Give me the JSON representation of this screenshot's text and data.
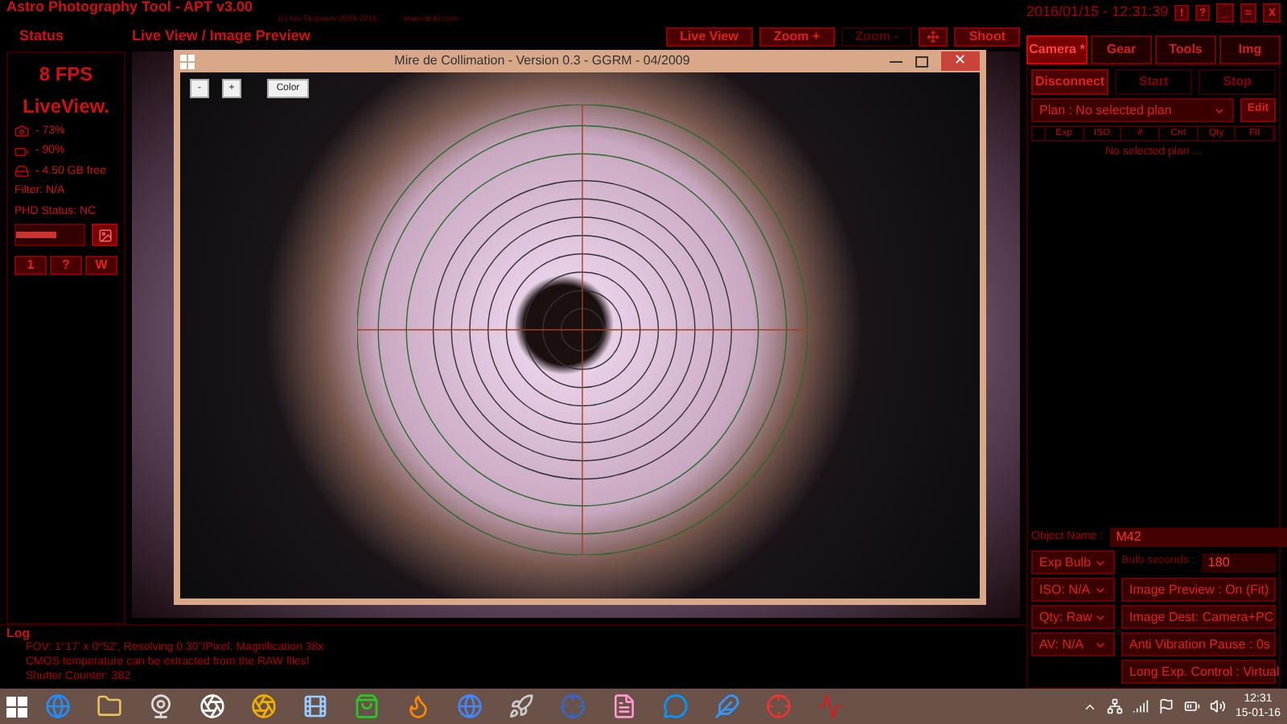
{
  "app": {
    "title": "Astro Photography Tool - APT v3.00",
    "copyright": "(c) Ivo Stoyanov 2009-2015",
    "website": "www.ideiki.com",
    "datetime": "2016/01/15 - 12:31:39",
    "close_glyph": "✕",
    "header_buttons": [
      "!",
      "?"
    ],
    "window_buttons": [
      "_",
      "=",
      "X"
    ]
  },
  "status": {
    "title": "Status",
    "fps": "8 FPS",
    "mode": "LiveView.",
    "rows": [
      {
        "kind": "camera",
        "text": "- 73%"
      },
      {
        "kind": "battery",
        "text": "- 90%"
      },
      {
        "kind": "disk",
        "text": "- 4.50 GB free"
      }
    ],
    "filter": "Filter: N/A",
    "phd": "PHD Status: NC",
    "slider": {
      "level": 0.6
    },
    "buttons": [
      "1",
      "?",
      "W"
    ]
  },
  "preview": {
    "title": "Live View / Image Preview",
    "toolbar": [
      {
        "kind": "text",
        "label": "Live View",
        "enabled": true
      },
      {
        "kind": "text",
        "label": "Zoom +",
        "enabled": true
      },
      {
        "kind": "text",
        "label": "Zoom -",
        "enabled": false
      },
      {
        "kind": "icon",
        "enabled": true
      },
      {
        "kind": "text",
        "label": "Shoot",
        "enabled": true
      }
    ]
  },
  "collimation_window": {
    "title": "Mire de Collimation - Version 0.3 - GGRM - 04/2009",
    "buttons": [
      "-",
      "+",
      "Color"
    ]
  },
  "log": {
    "title": "Log",
    "lines": [
      "FOV: 1°17' x 0°52', Resolving 0.30\"/Pixel, Magnification 38x",
      "CMOS temperature can be extracted from the RAW files!",
      "Shutter Counter: 382"
    ]
  },
  "tabs": [
    {
      "label": "Camera *",
      "selected": true
    },
    {
      "label": "Gear",
      "selected": false
    },
    {
      "label": "Tools",
      "selected": false
    },
    {
      "label": "Img",
      "selected": false
    }
  ],
  "camera": {
    "actions": [
      {
        "label": "Disconnect",
        "enabled": true
      },
      {
        "label": "Start",
        "enabled": false
      },
      {
        "label": "Stop",
        "enabled": false
      }
    ],
    "plan": "Plan : No selected plan",
    "edit": "Edit",
    "columns": [
      "Exp",
      "ISO",
      "#",
      "Cnt",
      "Qty",
      "Flt"
    ],
    "empty": "No selected plan ...",
    "object_label": "Object Name :",
    "object_value": "M42",
    "bulb_label": "Bulb seconds :",
    "bulb_value": "180",
    "left_settings": [
      "Exp Bulb",
      "ISO: N/A",
      "Qty: Raw",
      "AV: N/A"
    ],
    "right_settings": [
      "Image Preview : On (Fit)",
      "Image Dest: Camera+PC",
      "Anti Vibration Pause : 0s",
      "Long Exp. Control : Virtual"
    ]
  },
  "taskbar": {
    "time": "12:31",
    "date": "15-01-16"
  }
}
